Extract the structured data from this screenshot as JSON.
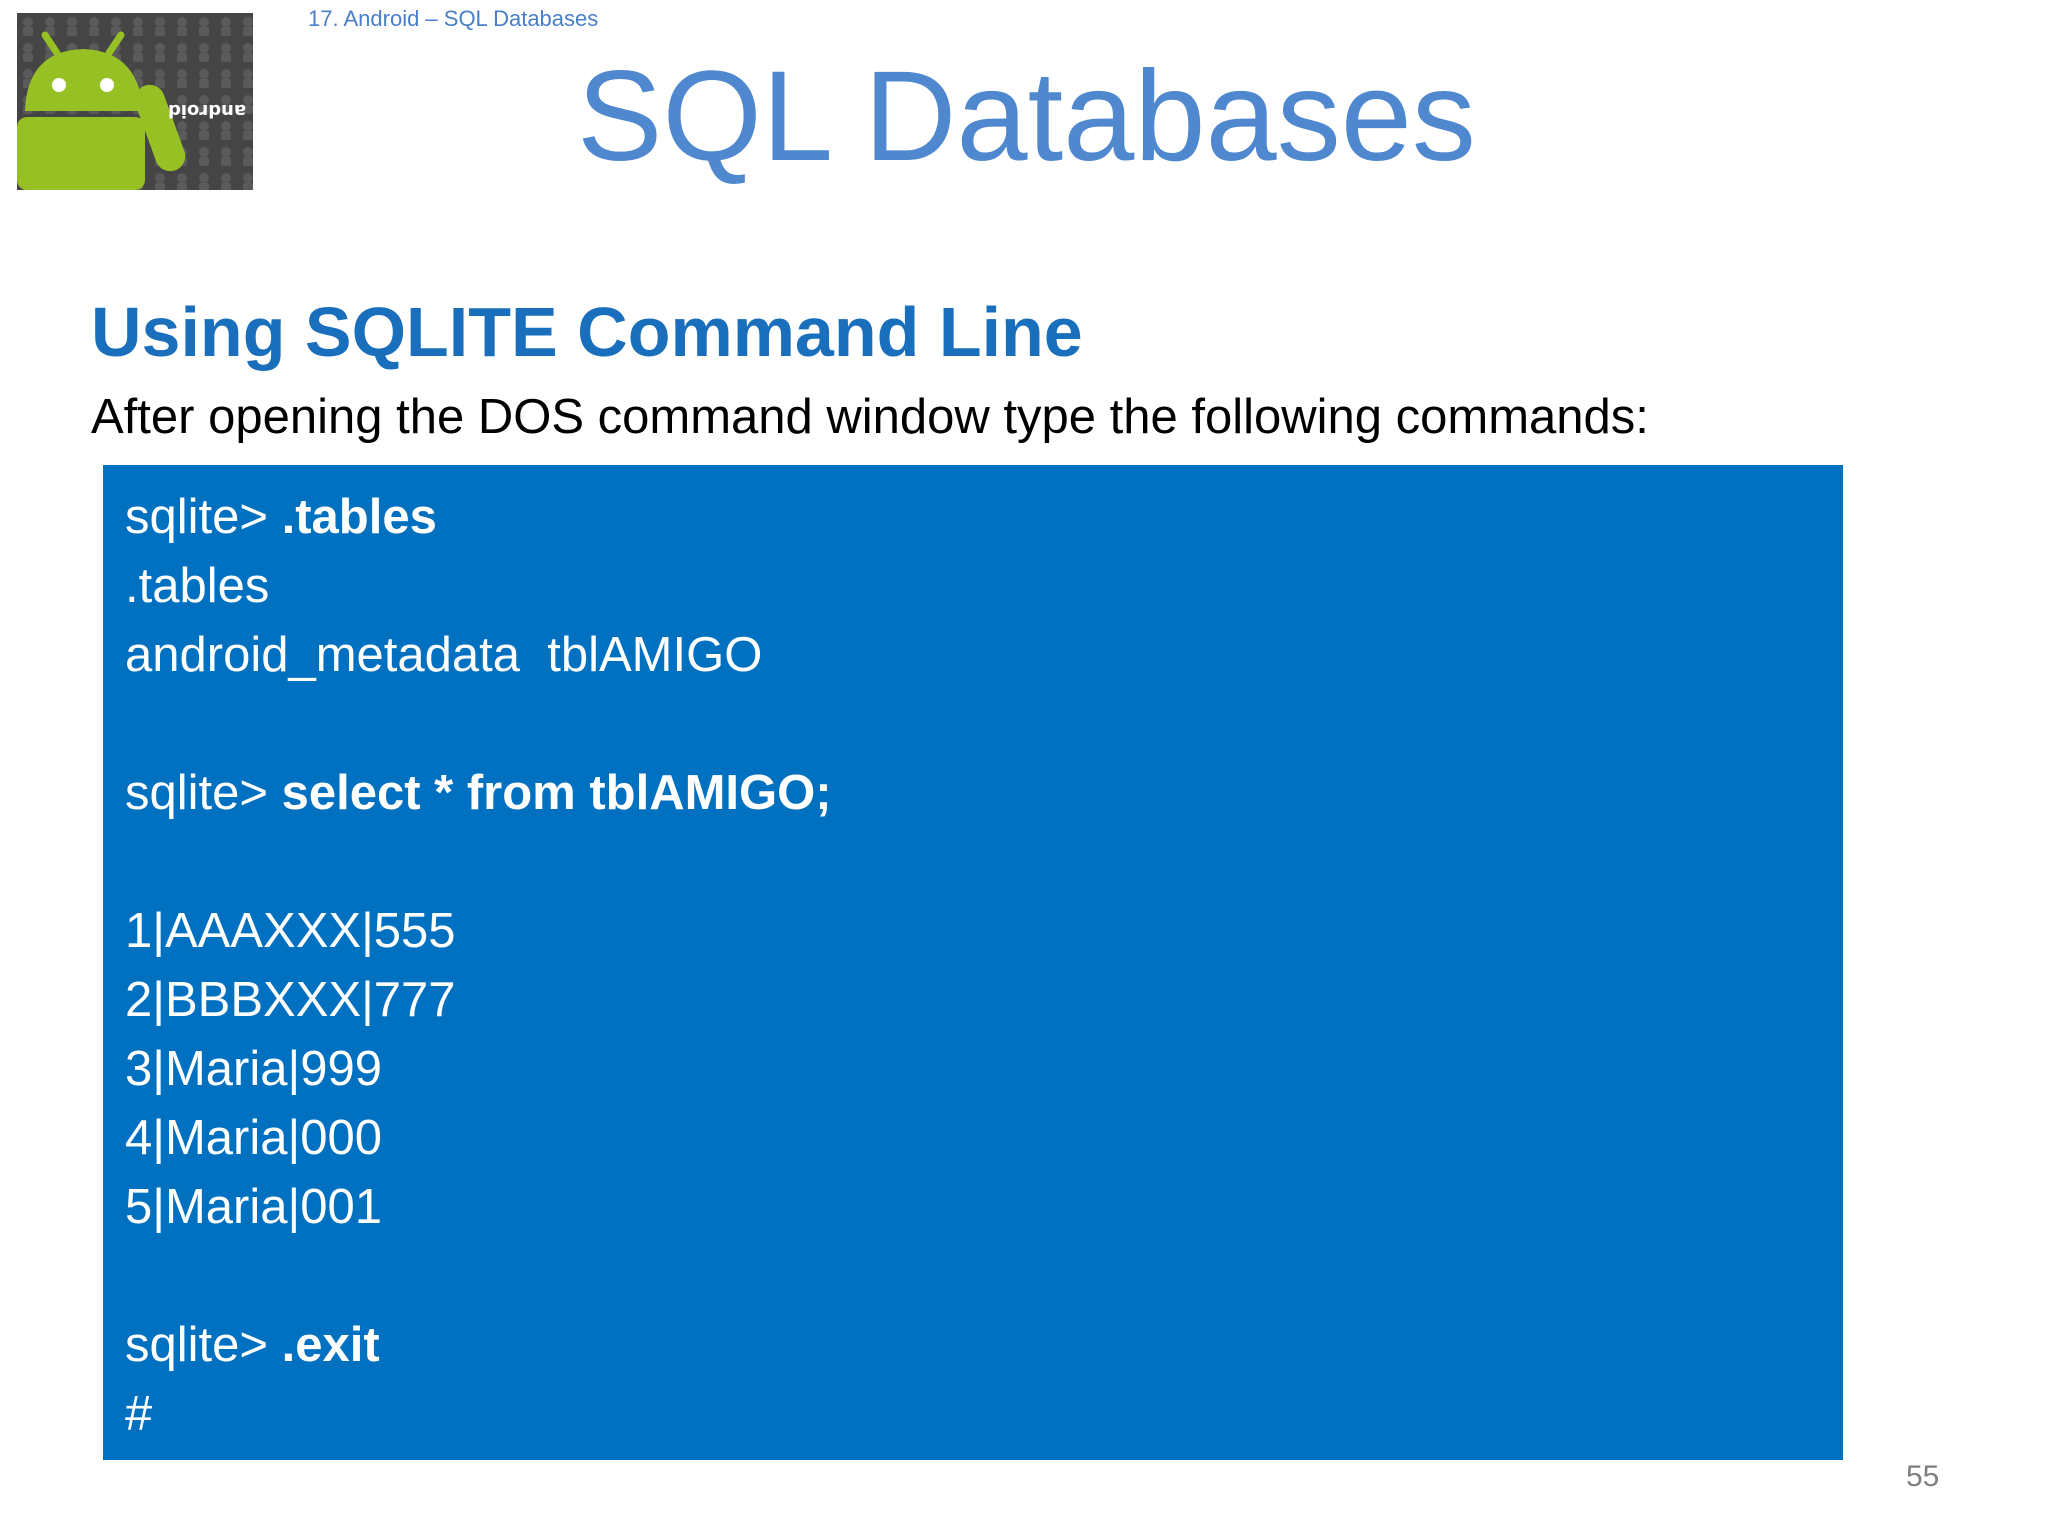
{
  "header": {
    "breadcrumb": "17. Android – SQL Databases",
    "title": "SQL Databases",
    "logo_text": "android"
  },
  "content": {
    "heading": "Using SQLITE Command Line",
    "intro": "After opening the DOS command window type the following commands:"
  },
  "console": {
    "background_color": "#0070c0",
    "lines": [
      {
        "prompt": "sqlite> ",
        "command": ".tables"
      },
      {
        "text": ".tables"
      },
      {
        "text": "android_metadata  tblAMIGO"
      },
      {
        "text": ""
      },
      {
        "prompt": "sqlite> ",
        "command": "select * from tblAMIGO;"
      },
      {
        "text": ""
      },
      {
        "text": "1|AAAXXX|555"
      },
      {
        "text": "2|BBBXXX|777"
      },
      {
        "text": "3|Maria|999"
      },
      {
        "text": "4|Maria|000"
      },
      {
        "text": "5|Maria|001"
      },
      {
        "text": ""
      },
      {
        "prompt": "sqlite> ",
        "command": ".exit"
      },
      {
        "text": "#"
      }
    ]
  },
  "footer": {
    "page_number": "55"
  },
  "colors": {
    "title": "#4f88cf",
    "heading": "#1a6fbd",
    "android_green": "#97c024"
  }
}
